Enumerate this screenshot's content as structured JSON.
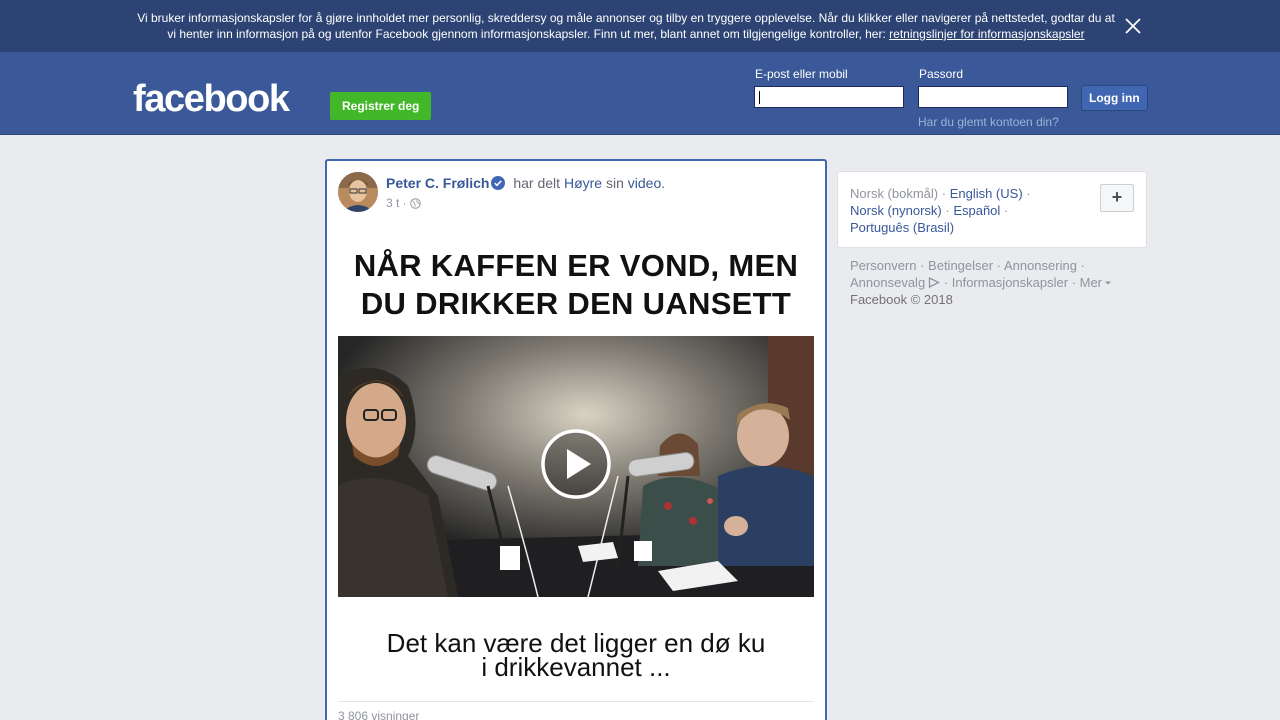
{
  "cookie_banner": {
    "line1": "Vi bruker informasjonskapsler for å gjøre innholdet mer personlig, skreddersy og måle annonser og tilby en tryggere opplevelse. Når du klikker eller navigerer på nettstedet, godtar du at",
    "line2": "vi henter inn informasjon på og utenfor Facebook gjennom informasjonskapsler. Finn ut mer, blant annet om tilgjengelige kontroller, her: ",
    "link": "retningslinjer for informasjonskapsler"
  },
  "header": {
    "logo": "facebook",
    "register_label": "Registrer deg",
    "email_label": "E-post eller mobil",
    "password_label": "Passord",
    "login_label": "Logg inn",
    "forgot_label": "Har du glemt kontoen din?"
  },
  "post": {
    "author": "Peter C. Frølich",
    "shared_text": " har delt ",
    "page": "Høyre",
    "possessive": " sin ",
    "object": "video",
    "period": ".",
    "time": "3 t",
    "dot": " ·",
    "top_caption_line1": "NÅR KAFFEN ER VOND, MEN",
    "top_caption_line2": "DU DRIKKER DEN UANSETT",
    "bottom_caption_line1": "Det kan være det ligger en dø ku",
    "bottom_caption_line2": "i drikkevannet ...",
    "views": "3 806 visninger"
  },
  "languages": {
    "current": "Norsk (bokmål)",
    "items": [
      "English (US)",
      "Norsk (nynorsk)",
      "Español",
      "Português (Brasil)"
    ],
    "sep": " · ",
    "more_label": "+"
  },
  "footer": {
    "links": [
      "Personvern",
      "Betingelser",
      "Annonsering",
      "Annonsevalg",
      "Informasjonskapsler",
      "Mer"
    ],
    "sep": " · ",
    "copyright": "Facebook © 2018"
  },
  "colors": {
    "brand": "#3b5998",
    "banner": "#2d4373",
    "register_green": "#42b72a",
    "link": "#385898"
  }
}
